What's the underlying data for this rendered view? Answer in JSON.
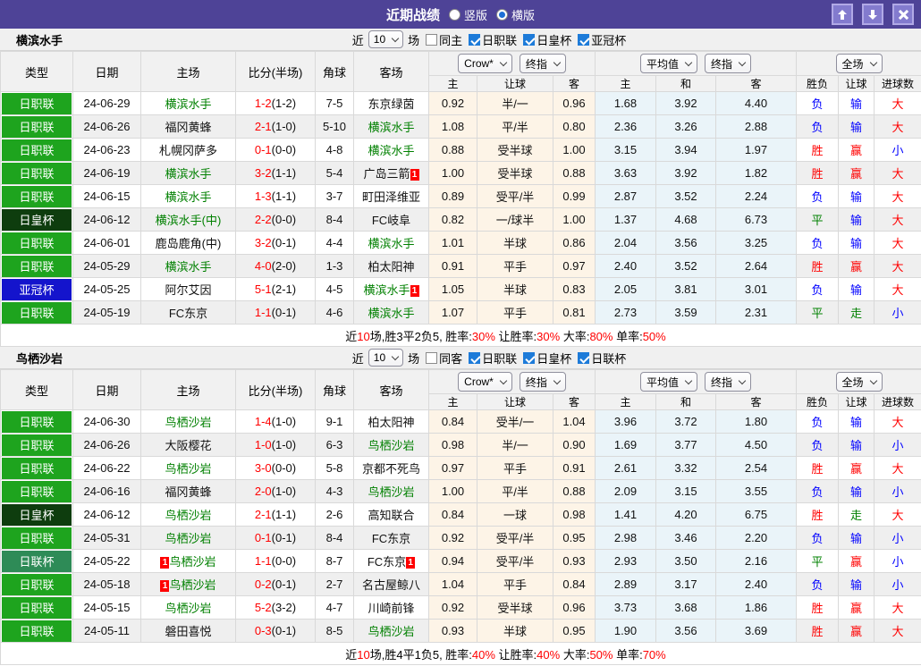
{
  "titlebar": {
    "title": "近期战绩",
    "layout_options": [
      {
        "label": "竖版",
        "selected": false
      },
      {
        "label": "横版",
        "selected": true
      }
    ],
    "window_buttons": [
      "scroll-up",
      "scroll-down",
      "close"
    ]
  },
  "league_colors": {
    "日职联": "#1ea41e",
    "日皇杯": "#0e3d0e",
    "亚冠杯": "#1414cc",
    "日联杯": "#2e8b57"
  },
  "result_colors": {
    "胜": "#ff0000",
    "赢": "#ff0000",
    "大": "#ff0000",
    "负": "#0000ff",
    "输": "#0000ff",
    "小": "#0000ff",
    "平": "#008000",
    "走": "#008000"
  },
  "sections": [
    {
      "team": "横滨水手",
      "filter": {
        "prefix": "近",
        "count": "10",
        "suffix": "场",
        "checkboxes": [
          {
            "label": "同主",
            "checked": false
          },
          {
            "label": "日职联",
            "checked": true
          },
          {
            "label": "日皇杯",
            "checked": true
          },
          {
            "label": "亚冠杯",
            "checked": true
          }
        ]
      },
      "header": {
        "left_cols": [
          "类型",
          "日期",
          "主场",
          "比分(半场)",
          "角球",
          "客场"
        ],
        "group1_selects": [
          "Crow*",
          "终指"
        ],
        "group1_cols": [
          "主",
          "让球",
          "客"
        ],
        "group2_selects": [
          "平均值",
          "终指"
        ],
        "group2_cols": [
          "主",
          "和",
          "客"
        ],
        "group3_selects": [
          "全场"
        ],
        "group3_cols": [
          "胜负",
          "让球",
          "进球数"
        ]
      },
      "rows": [
        {
          "league": "日职联",
          "date": "24-06-29",
          "home": {
            "name": "横滨水手",
            "highlight": true
          },
          "score_ft": "1-2",
          "score_ht": "(1-2)",
          "corners": "7-5",
          "away": {
            "name": "东京绿茵"
          },
          "asian": [
            "0.92",
            "半/一",
            "0.96"
          ],
          "euro": [
            "1.68",
            "3.92",
            "4.40"
          ],
          "results": [
            "负",
            "输",
            "大"
          ]
        },
        {
          "league": "日职联",
          "date": "24-06-26",
          "home": {
            "name": "福冈黄蜂"
          },
          "score_ft": "2-1",
          "score_ht": "(1-0)",
          "corners": "5-10",
          "away": {
            "name": "横滨水手",
            "highlight": true
          },
          "asian": [
            "1.08",
            "平/半",
            "0.80"
          ],
          "euro": [
            "2.36",
            "3.26",
            "2.88"
          ],
          "results": [
            "负",
            "输",
            "大"
          ]
        },
        {
          "league": "日职联",
          "date": "24-06-23",
          "home": {
            "name": "札幌冈萨多"
          },
          "score_ft": "0-1",
          "score_ht": "(0-0)",
          "corners": "4-8",
          "away": {
            "name": "横滨水手",
            "highlight": true
          },
          "asian": [
            "0.88",
            "受半球",
            "1.00"
          ],
          "euro": [
            "3.15",
            "3.94",
            "1.97"
          ],
          "results": [
            "胜",
            "赢",
            "小"
          ]
        },
        {
          "league": "日职联",
          "date": "24-06-19",
          "home": {
            "name": "横滨水手",
            "highlight": true
          },
          "score_ft": "3-2",
          "score_ht": "(1-1)",
          "corners": "5-4",
          "away": {
            "name": "广岛三箭",
            "card_after": "1"
          },
          "asian": [
            "1.00",
            "受半球",
            "0.88"
          ],
          "euro": [
            "3.63",
            "3.92",
            "1.82"
          ],
          "results": [
            "胜",
            "赢",
            "大"
          ]
        },
        {
          "league": "日职联",
          "date": "24-06-15",
          "home": {
            "name": "横滨水手",
            "highlight": true
          },
          "score_ft": "1-3",
          "score_ht": "(1-1)",
          "corners": "3-7",
          "away": {
            "name": "町田泽维亚"
          },
          "asian": [
            "0.89",
            "受平/半",
            "0.99"
          ],
          "euro": [
            "2.87",
            "3.52",
            "2.24"
          ],
          "results": [
            "负",
            "输",
            "大"
          ]
        },
        {
          "league": "日皇杯",
          "date": "24-06-12",
          "home": {
            "name": "横滨水手(中)",
            "highlight": true
          },
          "score_ft": "2-2",
          "score_ht": "(0-0)",
          "corners": "8-4",
          "away": {
            "name": "FC岐阜"
          },
          "asian": [
            "0.82",
            "一/球半",
            "1.00"
          ],
          "euro": [
            "1.37",
            "4.68",
            "6.73"
          ],
          "results": [
            "平",
            "输",
            "大"
          ]
        },
        {
          "league": "日职联",
          "date": "24-06-01",
          "home": {
            "name": "鹿岛鹿角(中)"
          },
          "score_ft": "3-2",
          "score_ht": "(0-1)",
          "corners": "4-4",
          "away": {
            "name": "横滨水手",
            "highlight": true
          },
          "asian": [
            "1.01",
            "半球",
            "0.86"
          ],
          "euro": [
            "2.04",
            "3.56",
            "3.25"
          ],
          "results": [
            "负",
            "输",
            "大"
          ]
        },
        {
          "league": "日职联",
          "date": "24-05-29",
          "home": {
            "name": "横滨水手",
            "highlight": true
          },
          "score_ft": "4-0",
          "score_ht": "(2-0)",
          "corners": "1-3",
          "away": {
            "name": "柏太阳神"
          },
          "asian": [
            "0.91",
            "平手",
            "0.97"
          ],
          "euro": [
            "2.40",
            "3.52",
            "2.64"
          ],
          "results": [
            "胜",
            "赢",
            "大"
          ]
        },
        {
          "league": "亚冠杯",
          "date": "24-05-25",
          "home": {
            "name": "阿尔艾因"
          },
          "score_ft": "5-1",
          "score_ht": "(2-1)",
          "corners": "4-5",
          "away": {
            "name": "横滨水手",
            "highlight": true,
            "card_after": "1"
          },
          "asian": [
            "1.05",
            "半球",
            "0.83"
          ],
          "euro": [
            "2.05",
            "3.81",
            "3.01"
          ],
          "results": [
            "负",
            "输",
            "大"
          ]
        },
        {
          "league": "日职联",
          "date": "24-05-19",
          "home": {
            "name": "FC东京"
          },
          "score_ft": "1-1",
          "score_ht": "(0-1)",
          "corners": "4-6",
          "away": {
            "name": "横滨水手",
            "highlight": true
          },
          "asian": [
            "1.07",
            "平手",
            "0.81"
          ],
          "euro": [
            "2.73",
            "3.59",
            "2.31"
          ],
          "results": [
            "平",
            "走",
            "小"
          ]
        }
      ],
      "summary": [
        {
          "text": "近"
        },
        {
          "text": "10",
          "red": true
        },
        {
          "text": "场,胜3平2负5, 胜率:"
        },
        {
          "text": "30%",
          "red": true
        },
        {
          "text": " 让胜率:"
        },
        {
          "text": "30%",
          "red": true
        },
        {
          "text": " 大率:"
        },
        {
          "text": "80%",
          "red": true
        },
        {
          "text": " 单率:"
        },
        {
          "text": "50%",
          "red": true
        }
      ]
    },
    {
      "team": "鸟栖沙岩",
      "filter": {
        "prefix": "近",
        "count": "10",
        "suffix": "场",
        "checkboxes": [
          {
            "label": "同客",
            "checked": false
          },
          {
            "label": "日职联",
            "checked": true
          },
          {
            "label": "日皇杯",
            "checked": true
          },
          {
            "label": "日联杯",
            "checked": true
          }
        ]
      },
      "header": {
        "left_cols": [
          "类型",
          "日期",
          "主场",
          "比分(半场)",
          "角球",
          "客场"
        ],
        "group1_selects": [
          "Crow*",
          "终指"
        ],
        "group1_cols": [
          "主",
          "让球",
          "客"
        ],
        "group2_selects": [
          "平均值",
          "终指"
        ],
        "group2_cols": [
          "主",
          "和",
          "客"
        ],
        "group3_selects": [
          "全场"
        ],
        "group3_cols": [
          "胜负",
          "让球",
          "进球数"
        ]
      },
      "rows": [
        {
          "league": "日职联",
          "date": "24-06-30",
          "home": {
            "name": "鸟栖沙岩",
            "highlight": true
          },
          "score_ft": "1-4",
          "score_ht": "(1-0)",
          "corners": "9-1",
          "away": {
            "name": "柏太阳神"
          },
          "asian": [
            "0.84",
            "受半/一",
            "1.04"
          ],
          "euro": [
            "3.96",
            "3.72",
            "1.80"
          ],
          "results": [
            "负",
            "输",
            "大"
          ]
        },
        {
          "league": "日职联",
          "date": "24-06-26",
          "home": {
            "name": "大阪樱花"
          },
          "score_ft": "1-0",
          "score_ht": "(1-0)",
          "corners": "6-3",
          "away": {
            "name": "鸟栖沙岩",
            "highlight": true
          },
          "asian": [
            "0.98",
            "半/一",
            "0.90"
          ],
          "euro": [
            "1.69",
            "3.77",
            "4.50"
          ],
          "results": [
            "负",
            "输",
            "小"
          ]
        },
        {
          "league": "日职联",
          "date": "24-06-22",
          "home": {
            "name": "鸟栖沙岩",
            "highlight": true
          },
          "score_ft": "3-0",
          "score_ht": "(0-0)",
          "corners": "5-8",
          "away": {
            "name": "京都不死鸟"
          },
          "asian": [
            "0.97",
            "平手",
            "0.91"
          ],
          "euro": [
            "2.61",
            "3.32",
            "2.54"
          ],
          "results": [
            "胜",
            "赢",
            "大"
          ]
        },
        {
          "league": "日职联",
          "date": "24-06-16",
          "home": {
            "name": "福冈黄蜂"
          },
          "score_ft": "2-0",
          "score_ht": "(1-0)",
          "corners": "4-3",
          "away": {
            "name": "鸟栖沙岩",
            "highlight": true
          },
          "asian": [
            "1.00",
            "平/半",
            "0.88"
          ],
          "euro": [
            "2.09",
            "3.15",
            "3.55"
          ],
          "results": [
            "负",
            "输",
            "小"
          ]
        },
        {
          "league": "日皇杯",
          "date": "24-06-12",
          "home": {
            "name": "鸟栖沙岩",
            "highlight": true
          },
          "score_ft": "2-1",
          "score_ht": "(1-1)",
          "corners": "2-6",
          "away": {
            "name": "高知联合"
          },
          "asian": [
            "0.84",
            "一球",
            "0.98"
          ],
          "euro": [
            "1.41",
            "4.20",
            "6.75"
          ],
          "results": [
            "胜",
            "走",
            "大"
          ]
        },
        {
          "league": "日职联",
          "date": "24-05-31",
          "home": {
            "name": "鸟栖沙岩",
            "highlight": true
          },
          "score_ft": "0-1",
          "score_ht": "(0-1)",
          "corners": "8-4",
          "away": {
            "name": "FC东京"
          },
          "asian": [
            "0.92",
            "受平/半",
            "0.95"
          ],
          "euro": [
            "2.98",
            "3.46",
            "2.20"
          ],
          "results": [
            "负",
            "输",
            "小"
          ]
        },
        {
          "league": "日联杯",
          "date": "24-05-22",
          "home": {
            "name": "鸟栖沙岩",
            "highlight": true,
            "card_before": "1"
          },
          "score_ft": "1-1",
          "score_ht": "(0-0)",
          "corners": "8-7",
          "away": {
            "name": "FC东京",
            "card_after": "1"
          },
          "asian": [
            "0.94",
            "受平/半",
            "0.93"
          ],
          "euro": [
            "2.93",
            "3.50",
            "2.16"
          ],
          "results": [
            "平",
            "赢",
            "小"
          ]
        },
        {
          "league": "日职联",
          "date": "24-05-18",
          "home": {
            "name": "鸟栖沙岩",
            "highlight": true,
            "card_before": "1"
          },
          "score_ft": "0-2",
          "score_ht": "(0-1)",
          "corners": "2-7",
          "away": {
            "name": "名古屋鲸八"
          },
          "asian": [
            "1.04",
            "平手",
            "0.84"
          ],
          "euro": [
            "2.89",
            "3.17",
            "2.40"
          ],
          "results": [
            "负",
            "输",
            "小"
          ]
        },
        {
          "league": "日职联",
          "date": "24-05-15",
          "home": {
            "name": "鸟栖沙岩",
            "highlight": true
          },
          "score_ft": "5-2",
          "score_ht": "(3-2)",
          "corners": "4-7",
          "away": {
            "name": "川崎前锋"
          },
          "asian": [
            "0.92",
            "受半球",
            "0.96"
          ],
          "euro": [
            "3.73",
            "3.68",
            "1.86"
          ],
          "results": [
            "胜",
            "赢",
            "大"
          ]
        },
        {
          "league": "日职联",
          "date": "24-05-11",
          "home": {
            "name": "磐田喜悦"
          },
          "score_ft": "0-3",
          "score_ht": "(0-1)",
          "corners": "8-5",
          "away": {
            "name": "鸟栖沙岩",
            "highlight": true
          },
          "asian": [
            "0.93",
            "半球",
            "0.95"
          ],
          "euro": [
            "1.90",
            "3.56",
            "3.69"
          ],
          "results": [
            "胜",
            "赢",
            "大"
          ]
        }
      ],
      "summary": [
        {
          "text": "近"
        },
        {
          "text": "10",
          "red": true
        },
        {
          "text": "场,胜4平1负5, 胜率:"
        },
        {
          "text": "40%",
          "red": true
        },
        {
          "text": " 让胜率:"
        },
        {
          "text": "40%",
          "red": true
        },
        {
          "text": " 大率:"
        },
        {
          "text": "50%",
          "red": true
        },
        {
          "text": " 单率:"
        },
        {
          "text": "70%",
          "red": true
        }
      ]
    }
  ]
}
